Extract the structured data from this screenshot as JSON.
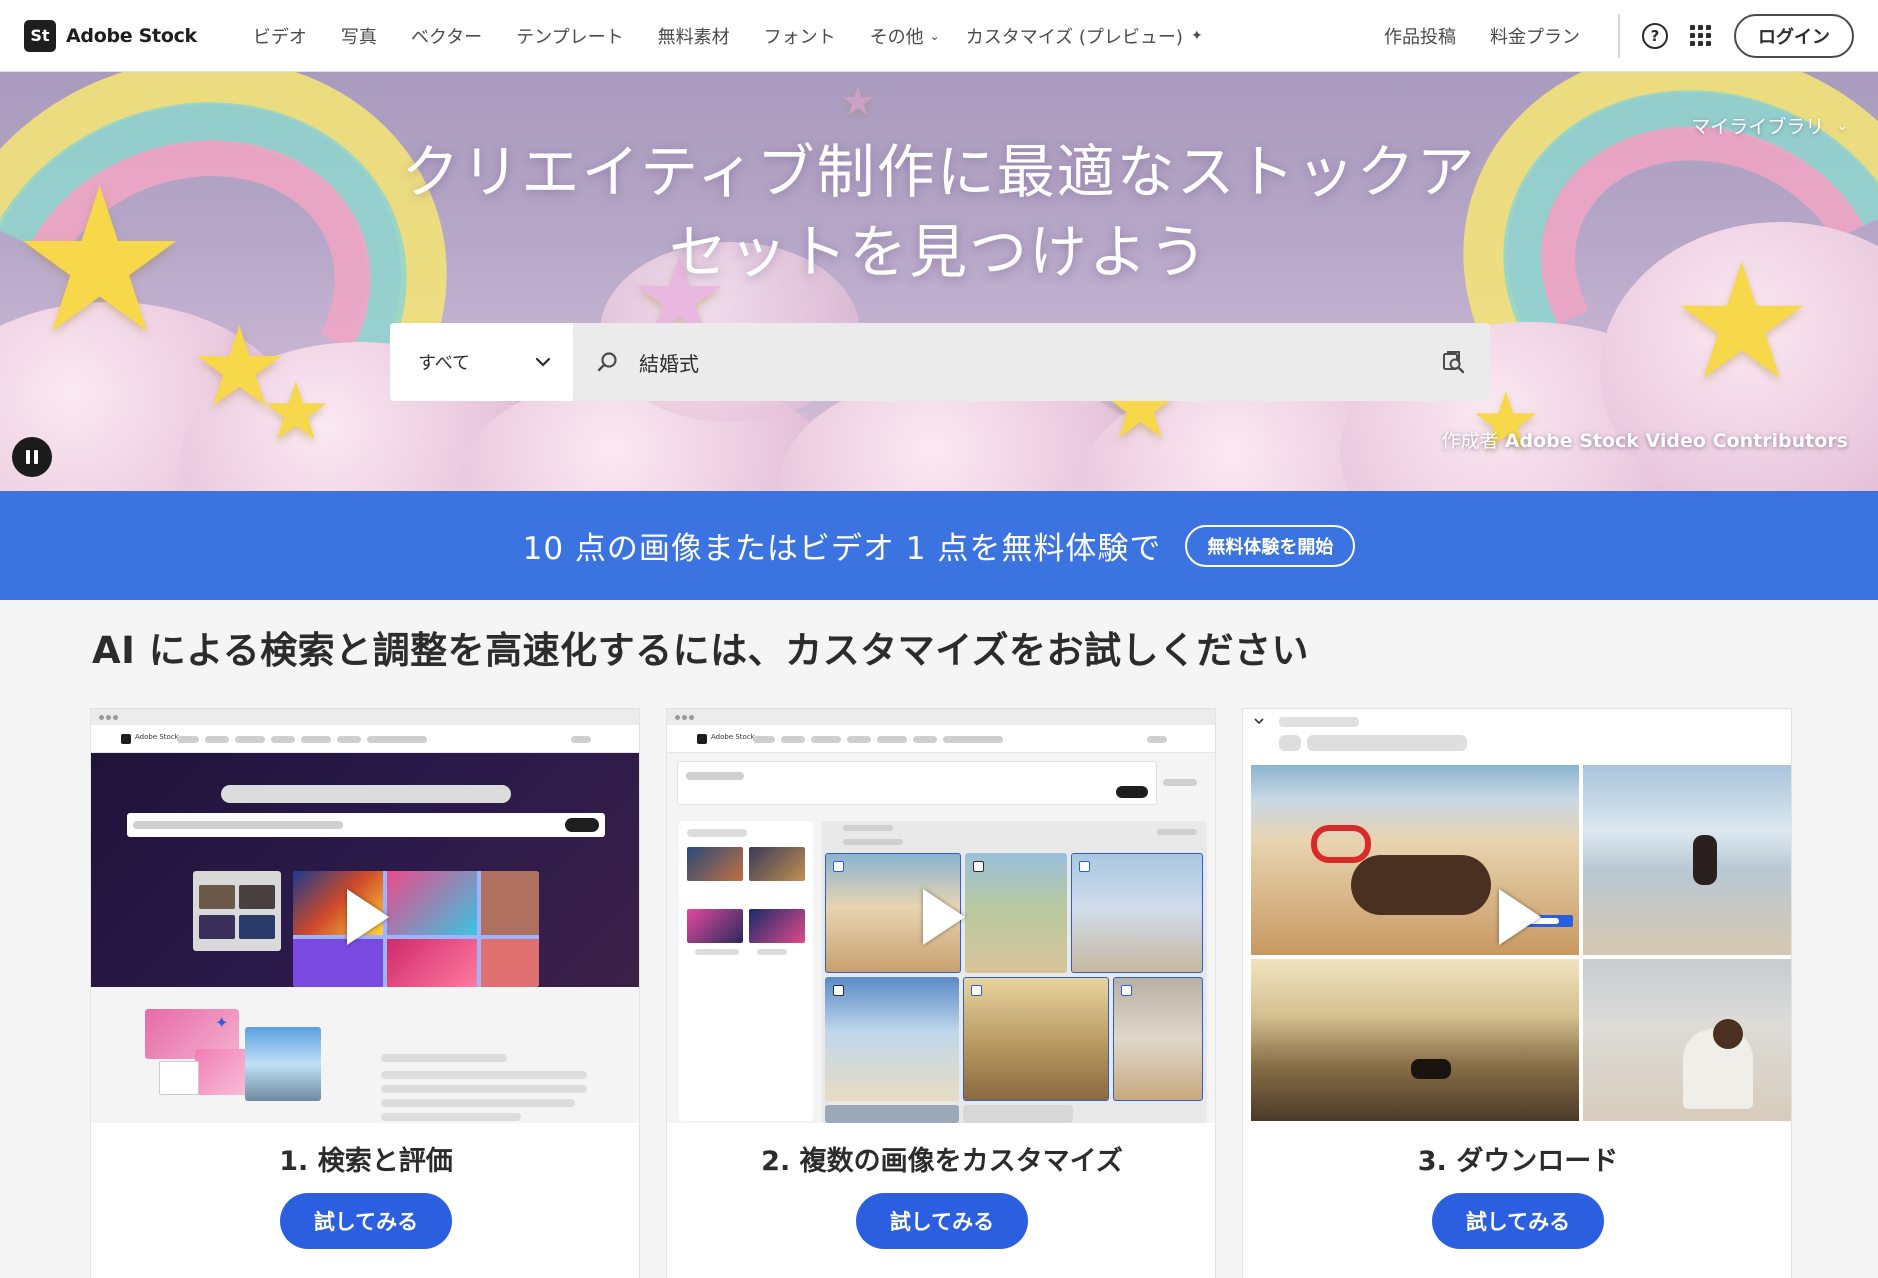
{
  "nav": {
    "brand_mark": "St",
    "brand_name": "Adobe Stock",
    "items": [
      "ビデオ",
      "写真",
      "ベクター",
      "テンプレート",
      "無料素材",
      "フォント"
    ],
    "more_label": "その他",
    "customize_label": "カスタマイズ (プレビュー)",
    "right_items": [
      "作品投稿",
      "料金プラン"
    ],
    "help_glyph": "?",
    "login_label": "ログイン"
  },
  "hero": {
    "title_line1": "クリエイティブ制作に最適なストックア",
    "title_line2": "セットを見つけよう",
    "my_library": "マイライブラリ",
    "search_type": "すべて",
    "search_value": "結婚式",
    "credit_prefix": "作成者",
    "credit_name": "Adobe Stock Video Contributors"
  },
  "promo": {
    "text": "10 点の画像またはビデオ 1 点を無料体験で",
    "button": "無料体験を開始"
  },
  "section": {
    "title": "AI による検索と調整を高速化するには、カスタマイズをお試しください"
  },
  "cards": [
    {
      "title": "1. 検索と評価",
      "button": "試してみる",
      "mini_brand": "Adobe Stock"
    },
    {
      "title": "2. 複数の画像をカスタマイズ",
      "button": "試してみる",
      "mini_brand": "Adobe Stock"
    },
    {
      "title": "3. ダウンロード",
      "button": "試してみる"
    }
  ],
  "colors": {
    "promo_blue": "#3b73e0",
    "button_blue": "#2c5ee0",
    "hero_purple": "#b6a7c8"
  },
  "icons": [
    "adobe-stock-logo",
    "chevron-down-icon",
    "sparkle-icon",
    "help-icon",
    "app-grid-icon",
    "search-icon",
    "visual-search-icon",
    "pause-icon",
    "play-icon"
  ]
}
